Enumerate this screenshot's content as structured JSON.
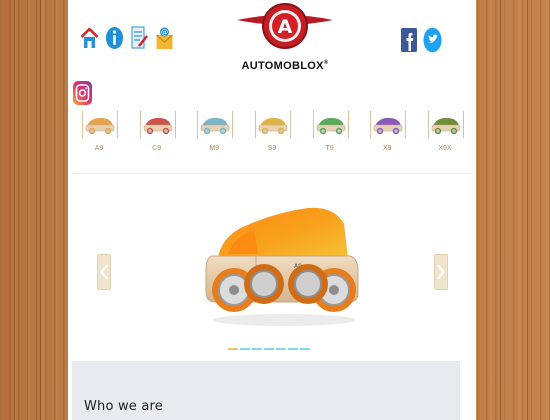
{
  "brand": {
    "name": "AUTOMOBLOX",
    "registered_mark": "®",
    "emblem_letter": "A",
    "primary_color": "#d32027"
  },
  "header": {
    "left_icons": [
      "home-icon",
      "info-icon",
      "edit-icon",
      "mail-icon"
    ],
    "right_icons": [
      "facebook-icon",
      "twitter-icon"
    ],
    "extra_icon": "instagram-icon"
  },
  "models": [
    {
      "label": "A9",
      "color": "#e3a34c"
    },
    {
      "label": "C9",
      "color": "#c9554b"
    },
    {
      "label": "M9",
      "color": "#7cb5c9"
    },
    {
      "label": "S9",
      "color": "#e0b24a"
    },
    {
      "label": "T9",
      "color": "#5aa95c"
    },
    {
      "label": "X9",
      "color": "#8a5ab8"
    },
    {
      "label": "X9X",
      "color": "#6e8f3a"
    }
  ],
  "carousel": {
    "slide_count": 7,
    "active_index": 0,
    "hero_color": "#f39a1e"
  },
  "about": {
    "title": "Who we are"
  }
}
